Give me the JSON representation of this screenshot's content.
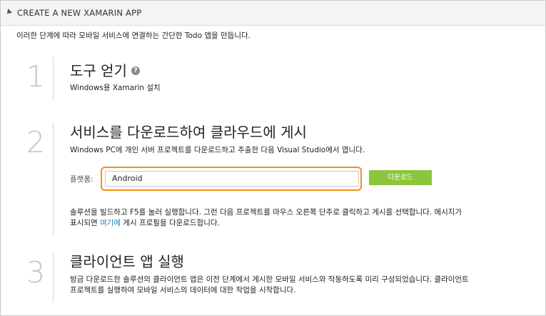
{
  "header": {
    "title": "CREATE A NEW XAMARIN APP",
    "collapse_icon": "collapse-triangle-icon"
  },
  "intro": "이러한 단계에 따라 모바일 서비스에 연결하는 간단한 Todo 앱을 만듭니다.",
  "steps": [
    {
      "number": "1",
      "title": "도구 얻기",
      "help_icon": "question-mark",
      "link": "Windows용 Xamarin 설치"
    },
    {
      "number": "2",
      "title": "서비스를 다운로드하여 클라우드에 게시",
      "description": "Windows PC에 개인 서버 프로젝트를 다운로드하고 추출한 다음 Visual Studio에서 엽니다.",
      "platform_label": "플랫폼:",
      "platform_value": "Android",
      "download_label": "다운로드",
      "note_line1": "솔루션을 빌드하고 F5를 눌러 실행합니다. 그런 다음 프로젝트를 마우스 오른쪽 단추로 클릭하고 게시를 선택합니다. 메시지가",
      "note_line2_prefix": "표시되면 ",
      "note_link": "여기에",
      "note_line2_suffix": " 게시 프로필을 다운로드합니다."
    },
    {
      "number": "3",
      "title": "클라이언트 앱 실행",
      "line1": "방금 다운로드한 솔루션의 클라이언트 앱은 이전 단계에서 게시한 모바일 서비스와 작동하도록 미리 구성되었습니다. 클라이언트",
      "line2": "프로젝트를 실행하여 모바일 서비스의 데이터에 대한 작업을 시작합니다."
    }
  ],
  "colors": {
    "accent_orange": "#f0921e",
    "download_green": "#8cc63e",
    "link_blue": "#1a7fb8"
  }
}
